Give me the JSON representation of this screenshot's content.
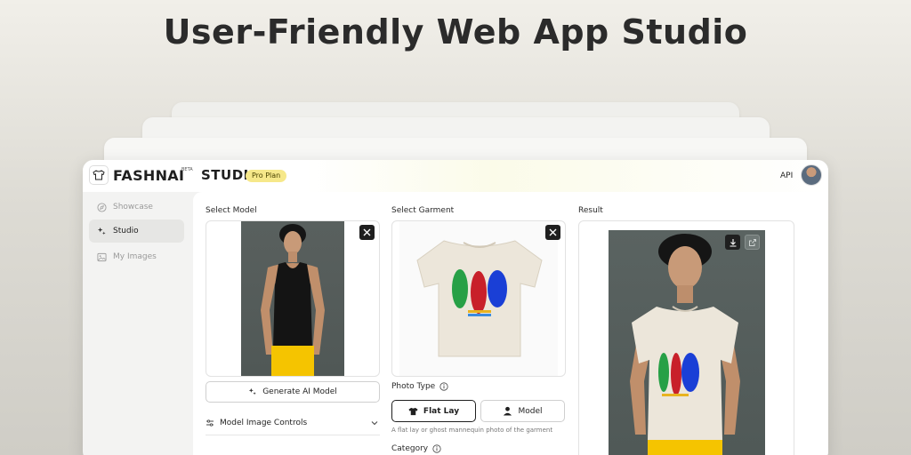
{
  "hero": {
    "title": "User-Friendly Web App Studio"
  },
  "topbar": {
    "brand": "FASHNAI",
    "beta": "BETA",
    "studio": "STUDIO",
    "plan": "Pro Plan",
    "api": "API"
  },
  "sidebar": {
    "items": [
      {
        "label": "Showcase",
        "icon": "compass-icon",
        "active": false
      },
      {
        "label": "Studio",
        "icon": "sparkles-icon",
        "active": true
      },
      {
        "label": "My Images",
        "icon": "image-icon",
        "active": false
      }
    ]
  },
  "model_panel": {
    "label": "Select Model",
    "generate_button": "Generate AI Model",
    "controls_label": "Model Image Controls"
  },
  "garment_panel": {
    "label": "Select Garment",
    "photo_type_label": "Photo Type",
    "flat_lay": "Flat Lay",
    "model": "Model",
    "helper": "A flat lay or ghost mannequin photo of the garment",
    "category_label": "Category"
  },
  "result_panel": {
    "label": "Result"
  },
  "colors": {
    "accent_badge": "#f6e88a",
    "pants": "#f5c400",
    "tank": "#151515",
    "tee": "#ece6da"
  }
}
